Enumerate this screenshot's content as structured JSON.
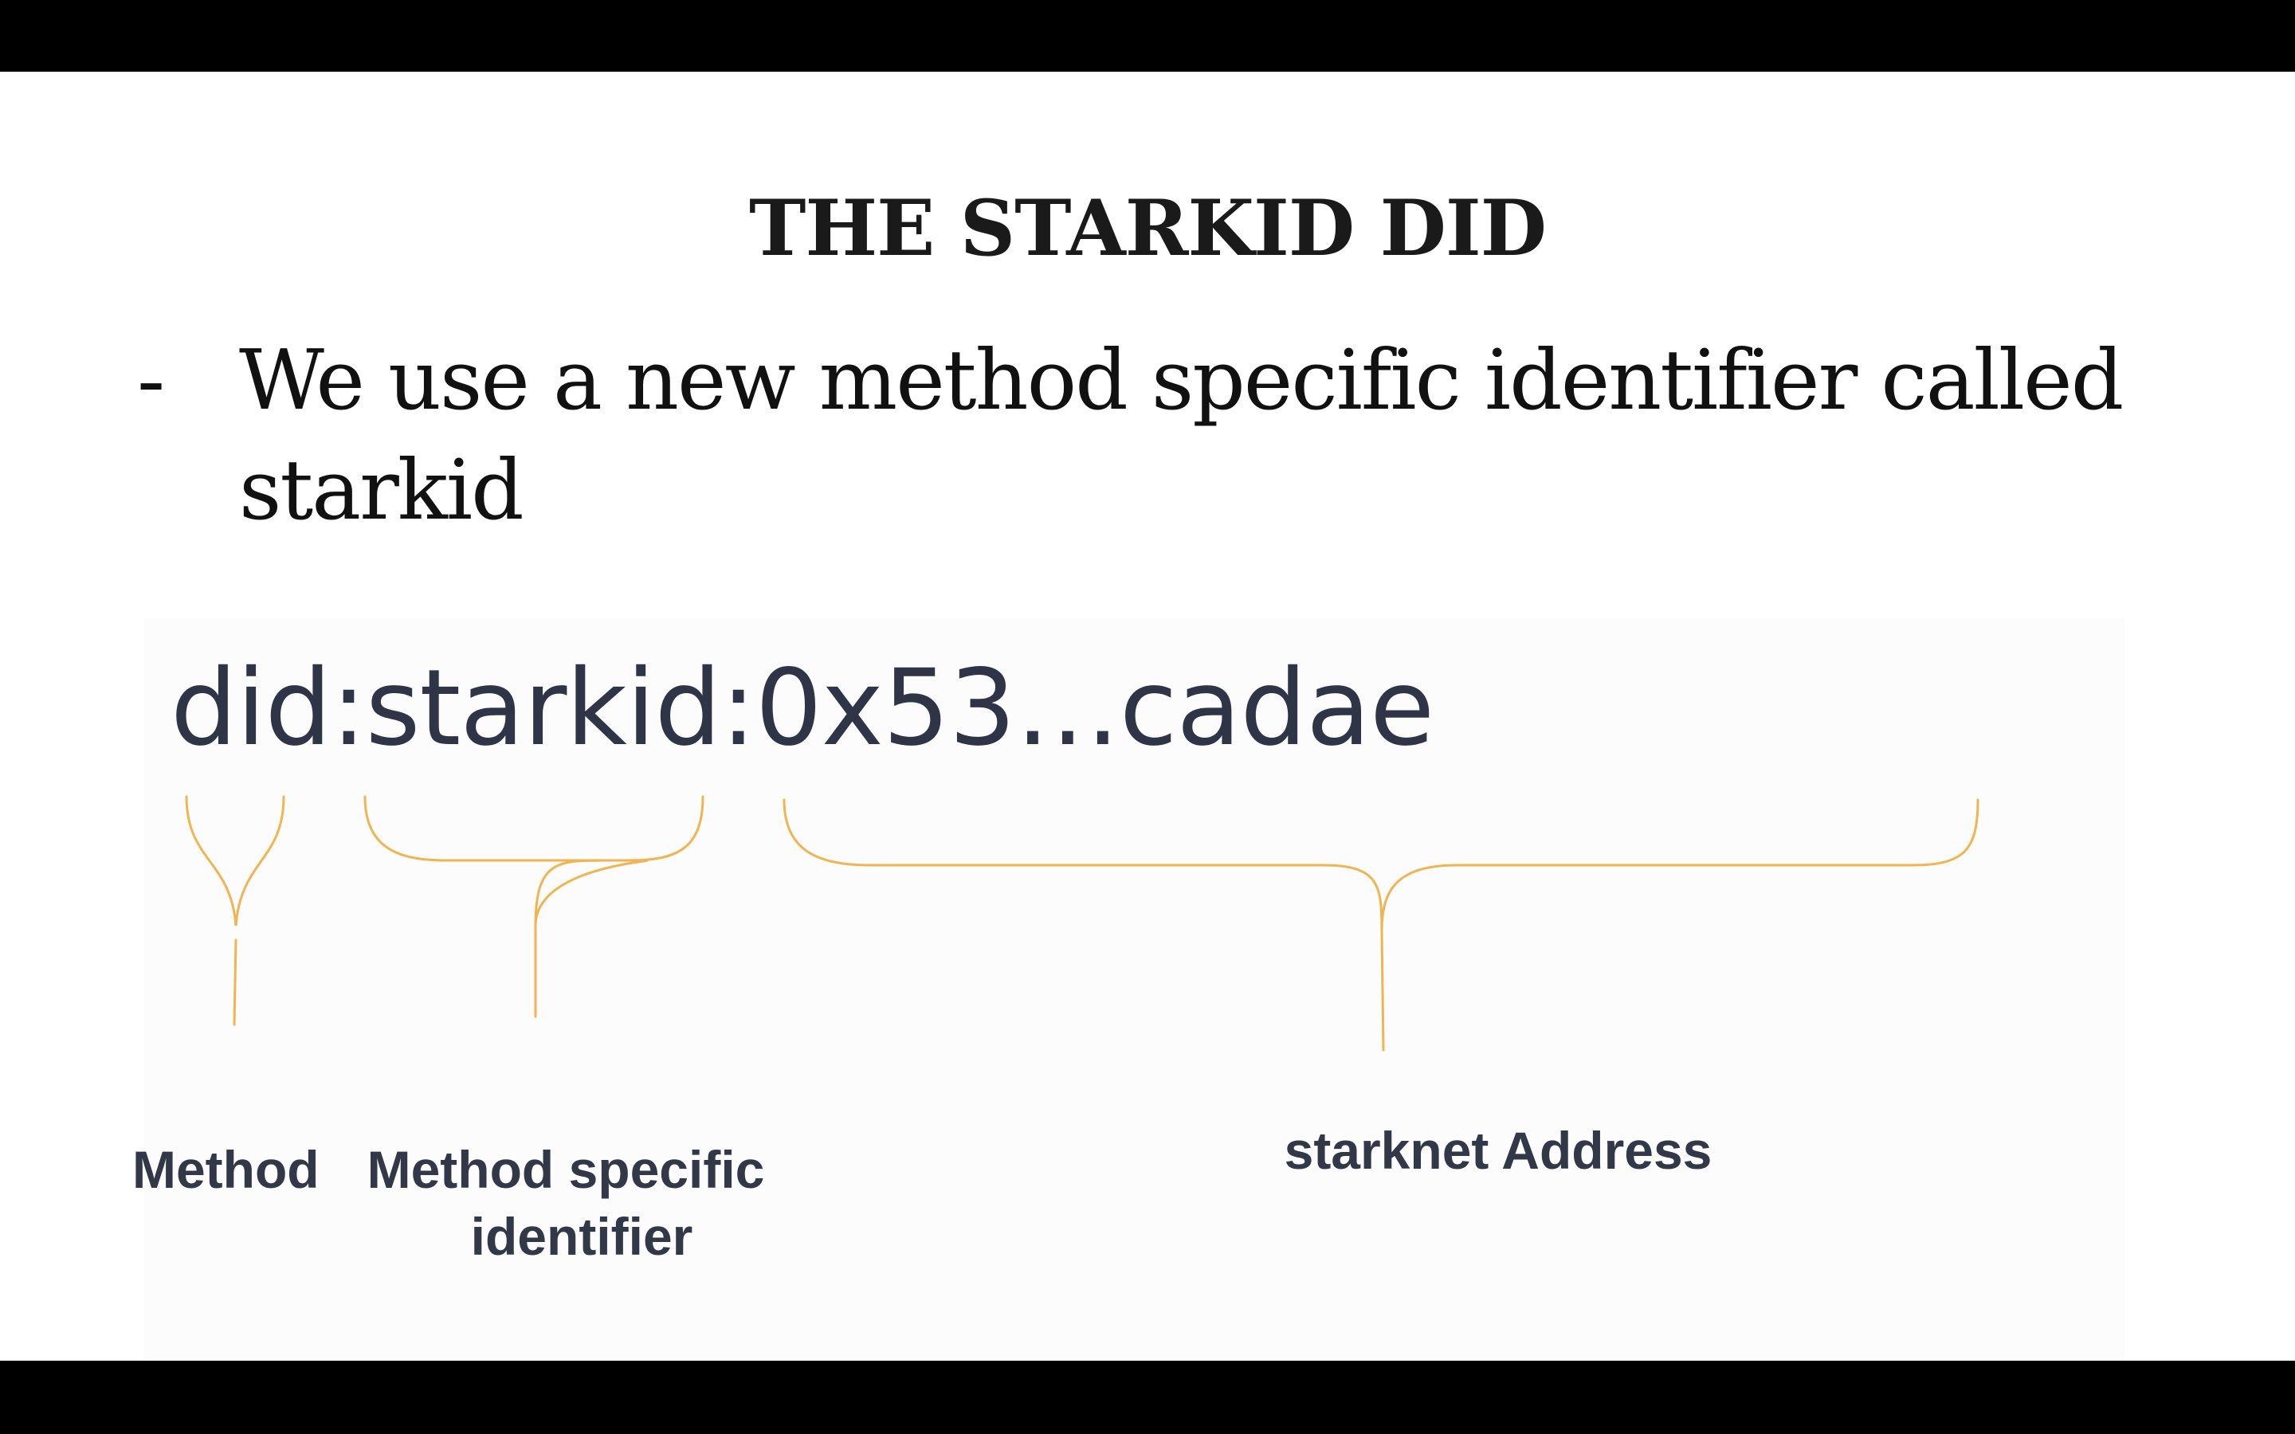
{
  "slide": {
    "title": "THE STARKID DID",
    "bullet": {
      "marker": "-",
      "text": "We use a new method specific identifier called starkid"
    },
    "did_string": "did:starkid:0x53…cadae",
    "labels": {
      "method": "Method",
      "method_specific_line1": "Method specific",
      "method_specific_line2": "identifier",
      "address": "starknet Address"
    },
    "colors": {
      "brace": "#f0b552",
      "did_text": "#2f3447",
      "label_text": "#333848",
      "background": "#ffffff",
      "letterbox": "#000000"
    }
  }
}
